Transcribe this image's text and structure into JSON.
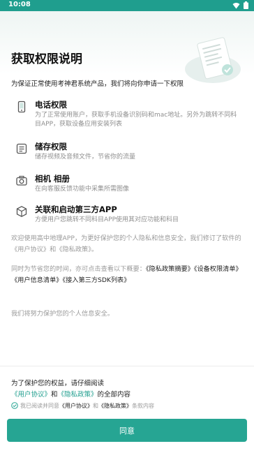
{
  "status_bar": {
    "time": "10:08"
  },
  "page": {
    "title": "获取权限说明",
    "intro": "为保证正常使用考神君系统产品，我们将向你申请一下权限"
  },
  "permissions": [
    {
      "icon": "phone-icon",
      "title": "电话权限",
      "desc": "为了正常使用账户，获取手机设备识别码和mac地址。另外为跳转不同科目APP，获取设备应用安装列表"
    },
    {
      "icon": "storage-icon",
      "title": "储存权限",
      "desc": "储存视频及音频文件，节省你的流量"
    },
    {
      "icon": "camera-icon",
      "title": "相机 相册",
      "desc": "在向客服反馈功能中采集所需图像"
    },
    {
      "icon": "cube-icon",
      "title": "关联和启动第三方APP",
      "desc": "方便用户您跳转不同科目APP使用其对应功能和科目"
    }
  ],
  "paragraphs": {
    "p1": "欢迎使用高中地理APP，为更好保护您的个人隐私和信息安全，我们修订了软件的《用户协议》和《隐私政策》。",
    "p2_prefix": "同时为节省您的时间，亦可点击查看以下概要：",
    "p2_links_line1": "《隐私政策摘要》《设备权限清单》",
    "p2_links_line2": "《用户信息清单》《接入第三方SDK列表》",
    "p3": "我们将努力保护您的个人信息安全。"
  },
  "bottom": {
    "line1": "为了保护您的权益，请仔细阅读",
    "link_user_agreement": "《用户协议》",
    "and": "和",
    "link_privacy_policy": "《隐私政策》",
    "suffix": "的全部内容",
    "consent_prefix": "我已阅读并同意",
    "consent_user_agreement": "《用户协议》",
    "consent_and": "和",
    "consent_privacy_policy": "《隐私政策》",
    "consent_suffix": "条款内容",
    "agree_label": "同意"
  },
  "colors": {
    "accent": "#26a593",
    "status_bar": "#1f9e8e"
  }
}
